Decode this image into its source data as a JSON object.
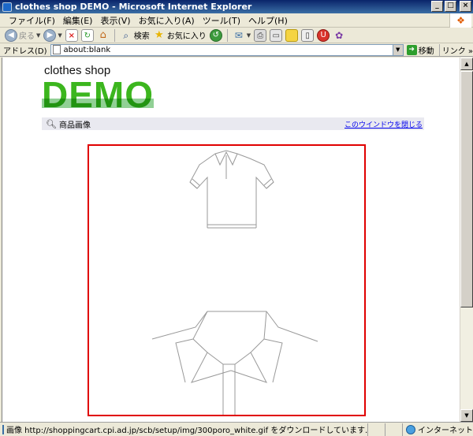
{
  "window": {
    "title": "clothes shop DEMO - Microsoft Internet Explorer",
    "min_label": "_",
    "max_label": "□",
    "close_label": "×"
  },
  "menu": [
    "ファイル(F)",
    "編集(E)",
    "表示(V)",
    "お気に入り(A)",
    "ツール(T)",
    "ヘルプ(H)"
  ],
  "toolbar": {
    "back_label": "戻る",
    "search_label": "検索",
    "favorites_label": "お気に入り"
  },
  "address": {
    "label": "アドレス(D)",
    "value": "about:blank",
    "go_label": "移動",
    "links_label": "リンク »"
  },
  "page": {
    "logo_small": "clothes shop",
    "logo_big": "DEMO",
    "image_bar_label": "商品画像",
    "close_window_link": "このウインドウを閉じる"
  },
  "status": {
    "text": "画像 http://shoppingcart.cpi.ad.jp/scb/setup/img/300poro_white.gif をダウンロードしています...",
    "zone": "インターネット"
  },
  "colors": {
    "frame_border": "#e00000",
    "logo_green": "#3cb61e",
    "link_blue": "#0000ee"
  }
}
